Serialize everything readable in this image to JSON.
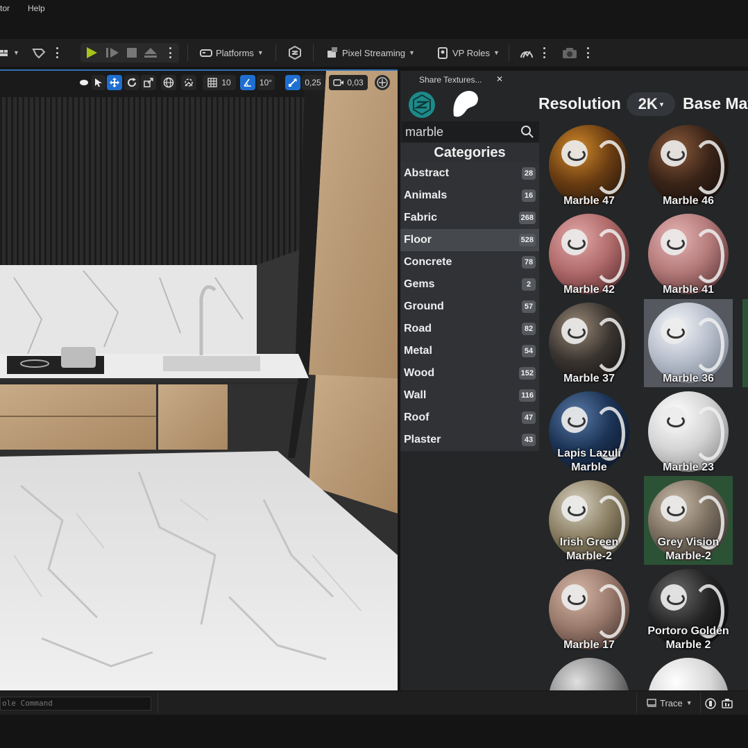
{
  "menu": {
    "partial_item": "tor",
    "help": "Help"
  },
  "toolbar": {
    "platforms": "Platforms",
    "pixel_streaming": "Pixel Streaming",
    "vp_roles": "VP Roles"
  },
  "viewport_toolbar": {
    "grid_snap": "10",
    "rotation_snap": "10°",
    "scale_snap": "0,25",
    "camera_speed": "0,03"
  },
  "panel": {
    "tab_title": "Share Textures...",
    "resolution_label": "Resolution",
    "resolution_value": "2K",
    "base_material_label": "Base Mat",
    "search": {
      "value": "marble"
    },
    "categories_title": "Categories",
    "categories": [
      {
        "label": "Abstract",
        "count": "28"
      },
      {
        "label": "Animals",
        "count": "16"
      },
      {
        "label": "Fabric",
        "count": "268"
      },
      {
        "label": "Floor",
        "count": "528"
      },
      {
        "label": "Concrete",
        "count": "78"
      },
      {
        "label": "Gems",
        "count": "2"
      },
      {
        "label": "Ground",
        "count": "57"
      },
      {
        "label": "Road",
        "count": "82"
      },
      {
        "label": "Metal",
        "count": "54"
      },
      {
        "label": "Wood",
        "count": "152"
      },
      {
        "label": "Wall",
        "count": "116"
      },
      {
        "label": "Roof",
        "count": "47"
      },
      {
        "label": "Plaster",
        "count": "43"
      }
    ],
    "materials": [
      {
        "line1": "Marble 47",
        "line2": ""
      },
      {
        "line1": "Marble 46",
        "line2": ""
      },
      {
        "line1": "Marble 42",
        "line2": ""
      },
      {
        "line1": "Marble 41",
        "line2": ""
      },
      {
        "line1": "Marble 37",
        "line2": ""
      },
      {
        "line1": "Marble 36",
        "line2": ""
      },
      {
        "line1": "Lapis Lazuli",
        "line2": "Marble"
      },
      {
        "line1": "Marble 23",
        "line2": ""
      },
      {
        "line1": "Irish Green",
        "line2": "Marble-2"
      },
      {
        "line1": "Grey Vision",
        "line2": "Marble-2"
      },
      {
        "line1": "Marble 17",
        "line2": ""
      },
      {
        "line1": "Portoro Golden",
        "line2": "Marble 2"
      }
    ]
  },
  "status": {
    "console_placeholder": "ole Command",
    "trace": "Trace"
  },
  "colors": {
    "accent_blue": "#1f6fd0",
    "play_green": "#a8c41c",
    "selected_green_tile": "#2c5236"
  }
}
